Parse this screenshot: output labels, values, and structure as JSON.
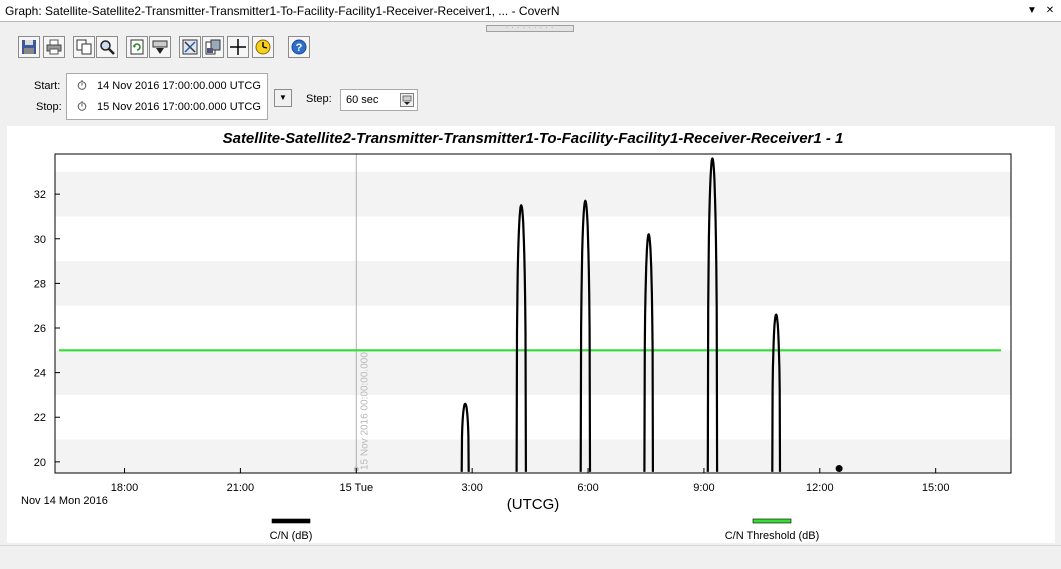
{
  "window": {
    "title": "Graph:  Satellite-Satellite2-Transmitter-Transmitter1-To-Facility-Facility1-Receiver-Receiver1, ... - CoverN",
    "buttons": [
      "▼",
      "✕"
    ]
  },
  "toolbar": {
    "icons": [
      "save-icon",
      "print-icon",
      "copy-icon",
      "zoom-icon",
      "refresh-icon",
      "export-icon",
      "properties-icon",
      "report-icon",
      "crosshair-icon",
      "clock-icon",
      "help-icon"
    ]
  },
  "time": {
    "start_label": "Start:",
    "stop_label": "Stop:",
    "start_value": "14 Nov 2016 17:00:00.000 UTCG",
    "stop_value": "15 Nov 2016 17:00:00.000 UTCG",
    "step_label": "Step:",
    "step_value": "60 sec"
  },
  "chart_data": {
    "type": "line",
    "title": "Satellite-Satellite2-Transmitter-Transmitter1-To-Facility-Facility1-Receiver-Receiver1  -  1",
    "xlabel": "(UTCG)",
    "x_hours_from_start": [
      0,
      24
    ],
    "xlim_hours": [
      -0.8,
      23.95
    ],
    "x_ticks": [
      {
        "h": 1,
        "label": "18:00"
      },
      {
        "h": 4,
        "label": "21:00"
      },
      {
        "h": 7,
        "label": "15 Tue"
      },
      {
        "h": 10,
        "label": "3:00"
      },
      {
        "h": 13,
        "label": "6:00"
      },
      {
        "h": 16,
        "label": "9:00"
      },
      {
        "h": 19,
        "label": "12:00"
      },
      {
        "h": 22,
        "label": "15:00"
      }
    ],
    "date_label": "Nov 14 Mon 2016",
    "ylim": [
      19.5,
      33.8
    ],
    "y_ticks": [
      20,
      22,
      24,
      26,
      28,
      30,
      32
    ],
    "marker_line": {
      "h": 7,
      "label": "15 Nov 2016 00:00:00.000"
    },
    "series": [
      {
        "name": "C/N (dB)",
        "color": "#000000",
        "passes": [
          {
            "center": 9.82,
            "halfwidth": 0.09,
            "peak": 22.6
          },
          {
            "center": 11.27,
            "halfwidth": 0.12,
            "peak": 31.5
          },
          {
            "center": 12.93,
            "halfwidth": 0.12,
            "peak": 31.7
          },
          {
            "center": 14.57,
            "halfwidth": 0.11,
            "peak": 30.2
          },
          {
            "center": 16.22,
            "halfwidth": 0.12,
            "peak": 33.6
          },
          {
            "center": 17.87,
            "halfwidth": 0.1,
            "peak": 26.6
          }
        ],
        "point": {
          "h": 19.5,
          "y": 19.7
        }
      },
      {
        "name": "C/N Threshold (dB)",
        "color": "#33dd33",
        "value": 25.0
      }
    ]
  }
}
